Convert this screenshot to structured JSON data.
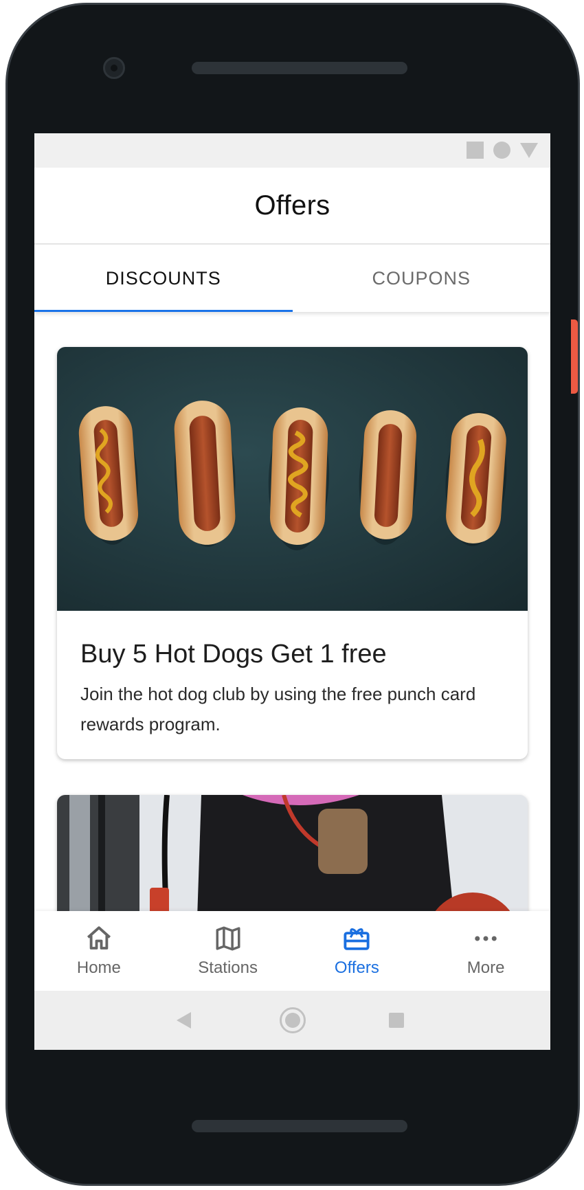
{
  "header": {
    "title": "Offers"
  },
  "tabs": [
    {
      "label": "DISCOUNTS",
      "active": true
    },
    {
      "label": "COUPONS",
      "active": false
    }
  ],
  "offers": [
    {
      "title": "Buy 5 Hot Dogs Get 1 free",
      "description": "Join the hot dog club by using the free punch card rewards program.",
      "image": "hot-dogs-photo"
    },
    {
      "image": "person-at-gas-pump-photo"
    }
  ],
  "bottom_nav": {
    "items": [
      {
        "label": "Home",
        "icon": "home-icon",
        "active": false
      },
      {
        "label": "Stations",
        "icon": "map-icon",
        "active": false
      },
      {
        "label": "Offers",
        "icon": "gift-card-icon",
        "active": true
      },
      {
        "label": "More",
        "icon": "more-dots-icon",
        "active": false
      }
    ]
  },
  "colors": {
    "accent": "#1a73e8",
    "phone_frame": "#121619",
    "power_button": "#ec5a43",
    "card_image_bg": "#1e3338"
  }
}
